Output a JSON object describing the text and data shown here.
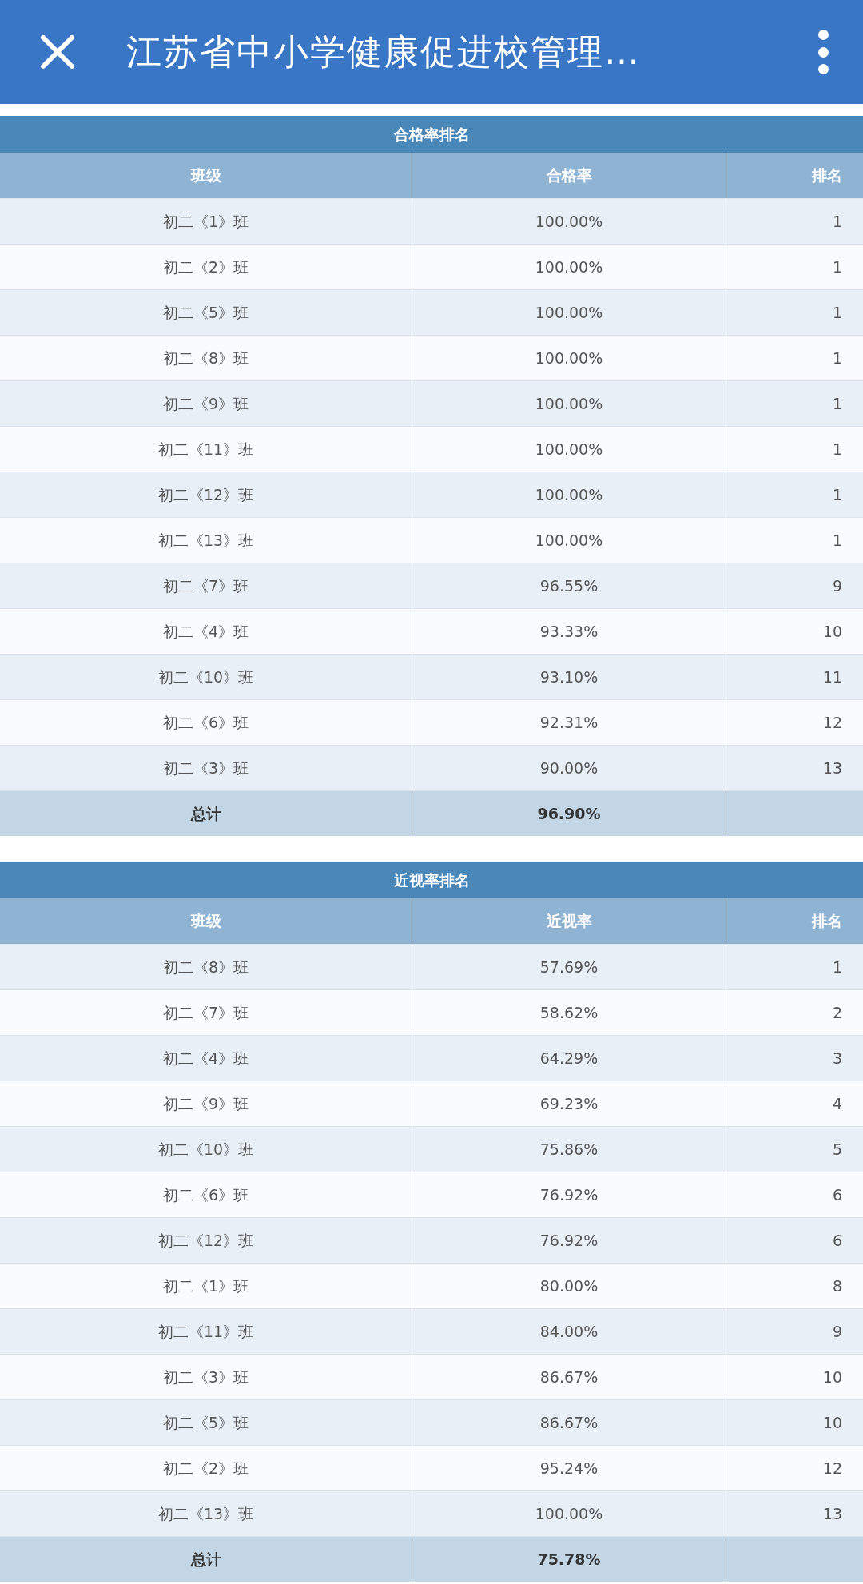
{
  "header": {
    "title": "江苏省中小学健康促进校管理…"
  },
  "tables": [
    {
      "title": "合格率排名",
      "columns": [
        "班级",
        "合格率",
        "排名"
      ],
      "rows": [
        [
          "初二《1》班",
          "100.00%",
          "1"
        ],
        [
          "初二《2》班",
          "100.00%",
          "1"
        ],
        [
          "初二《5》班",
          "100.00%",
          "1"
        ],
        [
          "初二《8》班",
          "100.00%",
          "1"
        ],
        [
          "初二《9》班",
          "100.00%",
          "1"
        ],
        [
          "初二《11》班",
          "100.00%",
          "1"
        ],
        [
          "初二《12》班",
          "100.00%",
          "1"
        ],
        [
          "初二《13》班",
          "100.00%",
          "1"
        ],
        [
          "初二《7》班",
          "96.55%",
          "9"
        ],
        [
          "初二《4》班",
          "93.33%",
          "10"
        ],
        [
          "初二《10》班",
          "93.10%",
          "11"
        ],
        [
          "初二《6》班",
          "92.31%",
          "12"
        ],
        [
          "初二《3》班",
          "90.00%",
          "13"
        ]
      ],
      "total": [
        "总计",
        "96.90%"
      ]
    },
    {
      "title": "近视率排名",
      "columns": [
        "班级",
        "近视率",
        "排名"
      ],
      "rows": [
        [
          "初二《8》班",
          "57.69%",
          "1"
        ],
        [
          "初二《7》班",
          "58.62%",
          "2"
        ],
        [
          "初二《4》班",
          "64.29%",
          "3"
        ],
        [
          "初二《9》班",
          "69.23%",
          "4"
        ],
        [
          "初二《10》班",
          "75.86%",
          "5"
        ],
        [
          "初二《6》班",
          "76.92%",
          "6"
        ],
        [
          "初二《12》班",
          "76.92%",
          "6"
        ],
        [
          "初二《1》班",
          "80.00%",
          "8"
        ],
        [
          "初二《11》班",
          "84.00%",
          "9"
        ],
        [
          "初二《3》班",
          "86.67%",
          "10"
        ],
        [
          "初二《5》班",
          "86.67%",
          "10"
        ],
        [
          "初二《2》班",
          "95.24%",
          "12"
        ],
        [
          "初二《13》班",
          "100.00%",
          "13"
        ]
      ],
      "total": [
        "总计",
        "75.78%"
      ]
    }
  ]
}
